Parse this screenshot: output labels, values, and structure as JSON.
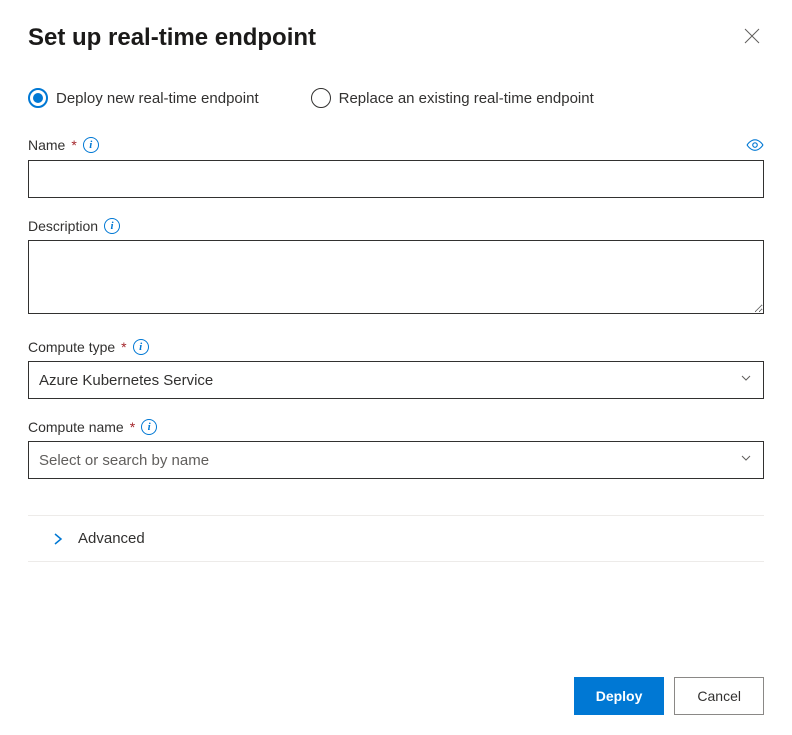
{
  "dialog": {
    "title": "Set up real-time endpoint"
  },
  "radio": {
    "deploy_new": "Deploy new real-time endpoint",
    "replace_existing": "Replace an existing real-time endpoint",
    "selected": "deploy_new"
  },
  "fields": {
    "name": {
      "label": "Name",
      "value": ""
    },
    "description": {
      "label": "Description",
      "value": ""
    },
    "compute_type": {
      "label": "Compute type",
      "value": "Azure Kubernetes Service"
    },
    "compute_name": {
      "label": "Compute name",
      "placeholder": "Select or search by name",
      "value": ""
    }
  },
  "advanced": {
    "label": "Advanced"
  },
  "footer": {
    "deploy": "Deploy",
    "cancel": "Cancel"
  }
}
